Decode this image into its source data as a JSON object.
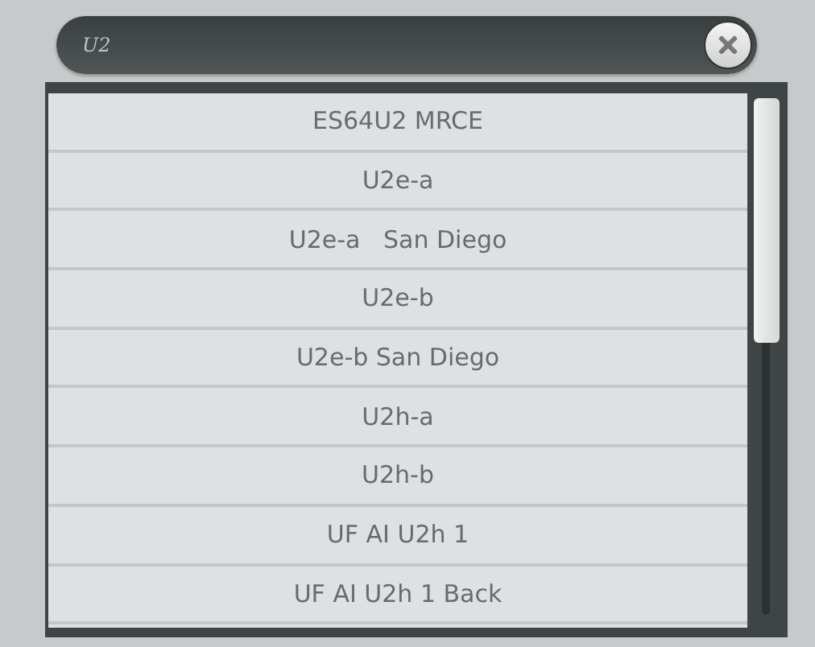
{
  "search": {
    "value": "U2"
  },
  "results": [
    "ES64U2 MRCE",
    "U2e-a",
    "U2e-a   San Diego",
    "U2e-b",
    "U2e-b San Diego",
    "U2h-a",
    "U2h-b",
    "UF AI U2h 1",
    "UF AI U2h 1 Back"
  ]
}
